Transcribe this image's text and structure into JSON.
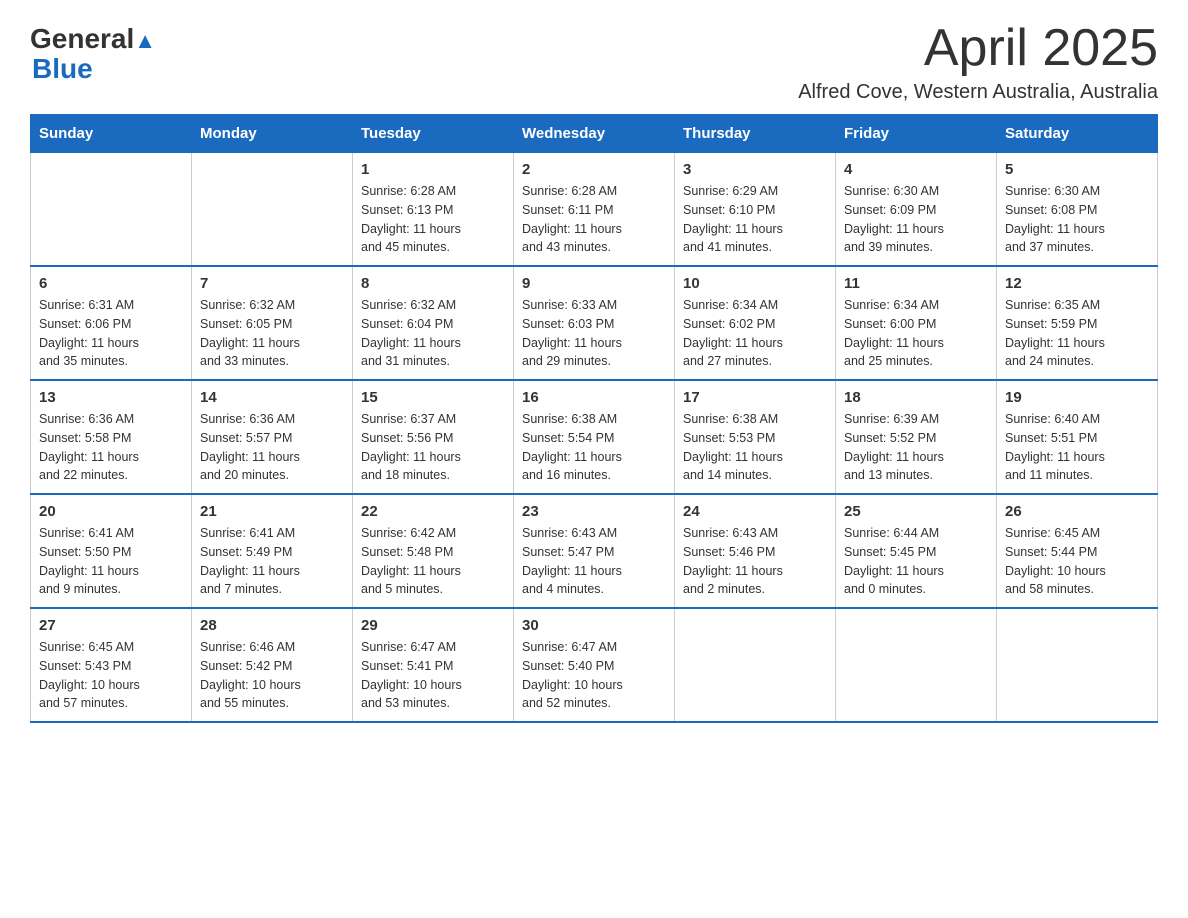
{
  "header": {
    "logo_text_black": "General",
    "logo_text_blue": "Blue",
    "month_title": "April 2025",
    "location": "Alfred Cove, Western Australia, Australia"
  },
  "weekdays": [
    "Sunday",
    "Monday",
    "Tuesday",
    "Wednesday",
    "Thursday",
    "Friday",
    "Saturday"
  ],
  "weeks": [
    [
      {
        "day": "",
        "info": ""
      },
      {
        "day": "",
        "info": ""
      },
      {
        "day": "1",
        "info": "Sunrise: 6:28 AM\nSunset: 6:13 PM\nDaylight: 11 hours\nand 45 minutes."
      },
      {
        "day": "2",
        "info": "Sunrise: 6:28 AM\nSunset: 6:11 PM\nDaylight: 11 hours\nand 43 minutes."
      },
      {
        "day": "3",
        "info": "Sunrise: 6:29 AM\nSunset: 6:10 PM\nDaylight: 11 hours\nand 41 minutes."
      },
      {
        "day": "4",
        "info": "Sunrise: 6:30 AM\nSunset: 6:09 PM\nDaylight: 11 hours\nand 39 minutes."
      },
      {
        "day": "5",
        "info": "Sunrise: 6:30 AM\nSunset: 6:08 PM\nDaylight: 11 hours\nand 37 minutes."
      }
    ],
    [
      {
        "day": "6",
        "info": "Sunrise: 6:31 AM\nSunset: 6:06 PM\nDaylight: 11 hours\nand 35 minutes."
      },
      {
        "day": "7",
        "info": "Sunrise: 6:32 AM\nSunset: 6:05 PM\nDaylight: 11 hours\nand 33 minutes."
      },
      {
        "day": "8",
        "info": "Sunrise: 6:32 AM\nSunset: 6:04 PM\nDaylight: 11 hours\nand 31 minutes."
      },
      {
        "day": "9",
        "info": "Sunrise: 6:33 AM\nSunset: 6:03 PM\nDaylight: 11 hours\nand 29 minutes."
      },
      {
        "day": "10",
        "info": "Sunrise: 6:34 AM\nSunset: 6:02 PM\nDaylight: 11 hours\nand 27 minutes."
      },
      {
        "day": "11",
        "info": "Sunrise: 6:34 AM\nSunset: 6:00 PM\nDaylight: 11 hours\nand 25 minutes."
      },
      {
        "day": "12",
        "info": "Sunrise: 6:35 AM\nSunset: 5:59 PM\nDaylight: 11 hours\nand 24 minutes."
      }
    ],
    [
      {
        "day": "13",
        "info": "Sunrise: 6:36 AM\nSunset: 5:58 PM\nDaylight: 11 hours\nand 22 minutes."
      },
      {
        "day": "14",
        "info": "Sunrise: 6:36 AM\nSunset: 5:57 PM\nDaylight: 11 hours\nand 20 minutes."
      },
      {
        "day": "15",
        "info": "Sunrise: 6:37 AM\nSunset: 5:56 PM\nDaylight: 11 hours\nand 18 minutes."
      },
      {
        "day": "16",
        "info": "Sunrise: 6:38 AM\nSunset: 5:54 PM\nDaylight: 11 hours\nand 16 minutes."
      },
      {
        "day": "17",
        "info": "Sunrise: 6:38 AM\nSunset: 5:53 PM\nDaylight: 11 hours\nand 14 minutes."
      },
      {
        "day": "18",
        "info": "Sunrise: 6:39 AM\nSunset: 5:52 PM\nDaylight: 11 hours\nand 13 minutes."
      },
      {
        "day": "19",
        "info": "Sunrise: 6:40 AM\nSunset: 5:51 PM\nDaylight: 11 hours\nand 11 minutes."
      }
    ],
    [
      {
        "day": "20",
        "info": "Sunrise: 6:41 AM\nSunset: 5:50 PM\nDaylight: 11 hours\nand 9 minutes."
      },
      {
        "day": "21",
        "info": "Sunrise: 6:41 AM\nSunset: 5:49 PM\nDaylight: 11 hours\nand 7 minutes."
      },
      {
        "day": "22",
        "info": "Sunrise: 6:42 AM\nSunset: 5:48 PM\nDaylight: 11 hours\nand 5 minutes."
      },
      {
        "day": "23",
        "info": "Sunrise: 6:43 AM\nSunset: 5:47 PM\nDaylight: 11 hours\nand 4 minutes."
      },
      {
        "day": "24",
        "info": "Sunrise: 6:43 AM\nSunset: 5:46 PM\nDaylight: 11 hours\nand 2 minutes."
      },
      {
        "day": "25",
        "info": "Sunrise: 6:44 AM\nSunset: 5:45 PM\nDaylight: 11 hours\nand 0 minutes."
      },
      {
        "day": "26",
        "info": "Sunrise: 6:45 AM\nSunset: 5:44 PM\nDaylight: 10 hours\nand 58 minutes."
      }
    ],
    [
      {
        "day": "27",
        "info": "Sunrise: 6:45 AM\nSunset: 5:43 PM\nDaylight: 10 hours\nand 57 minutes."
      },
      {
        "day": "28",
        "info": "Sunrise: 6:46 AM\nSunset: 5:42 PM\nDaylight: 10 hours\nand 55 minutes."
      },
      {
        "day": "29",
        "info": "Sunrise: 6:47 AM\nSunset: 5:41 PM\nDaylight: 10 hours\nand 53 minutes."
      },
      {
        "day": "30",
        "info": "Sunrise: 6:47 AM\nSunset: 5:40 PM\nDaylight: 10 hours\nand 52 minutes."
      },
      {
        "day": "",
        "info": ""
      },
      {
        "day": "",
        "info": ""
      },
      {
        "day": "",
        "info": ""
      }
    ]
  ]
}
